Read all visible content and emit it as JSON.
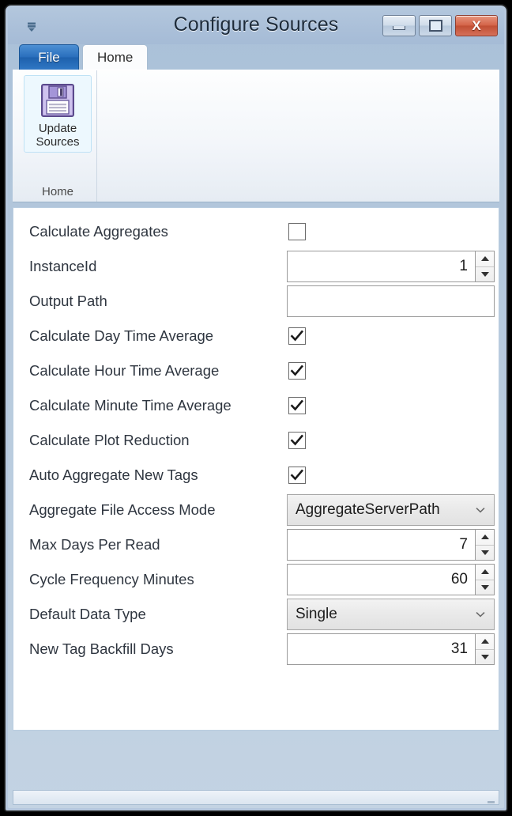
{
  "window": {
    "title": "Configure Sources",
    "quick_access_icon": "customize-quick-access-toolbar-icon",
    "buttons": {
      "minimize": "minimize-icon",
      "maximize": "maximize-icon",
      "close": "X"
    }
  },
  "ribbon": {
    "tabs": [
      {
        "label": "File",
        "selected": false
      },
      {
        "label": "Home",
        "selected": true
      }
    ],
    "group": {
      "label": "Home",
      "button": {
        "line1": "Update",
        "line2": "Sources",
        "icon": "save-floppy-disk-icon"
      }
    }
  },
  "form": {
    "rows": [
      {
        "label": "Calculate Aggregates",
        "type": "checkbox",
        "checked": false
      },
      {
        "label": "InstanceId",
        "type": "spinner",
        "value": "1"
      },
      {
        "label": "Output Path",
        "type": "text",
        "value": ""
      },
      {
        "label": "Calculate Day Time Average",
        "type": "checkbox",
        "checked": true
      },
      {
        "label": "Calculate Hour Time Average",
        "type": "checkbox",
        "checked": true
      },
      {
        "label": "Calculate Minute Time Average",
        "type": "checkbox",
        "checked": true
      },
      {
        "label": "Calculate Plot Reduction",
        "type": "checkbox",
        "checked": true
      },
      {
        "label": "Auto Aggregate New Tags",
        "type": "checkbox",
        "checked": true
      },
      {
        "label": "Aggregate File Access Mode",
        "type": "combo",
        "value": "AggregateServerPath"
      },
      {
        "label": "Max Days Per Read",
        "type": "spinner",
        "value": "7"
      },
      {
        "label": "Cycle Frequency Minutes",
        "type": "spinner",
        "value": "60"
      },
      {
        "label": "Default Data Type",
        "type": "combo",
        "value": "Single"
      },
      {
        "label": "New Tag Backfill Days",
        "type": "spinner",
        "value": "31"
      }
    ]
  },
  "statusbar": {
    "text": "",
    "grip": "resize-grip-icon"
  },
  "colors": {
    "titlebar": "#abc0d9",
    "file_tab": "#2a6fbd",
    "close_button": "#c14f34",
    "client_bg": "#ffffff",
    "accent_highlight": "#edf8fe"
  }
}
